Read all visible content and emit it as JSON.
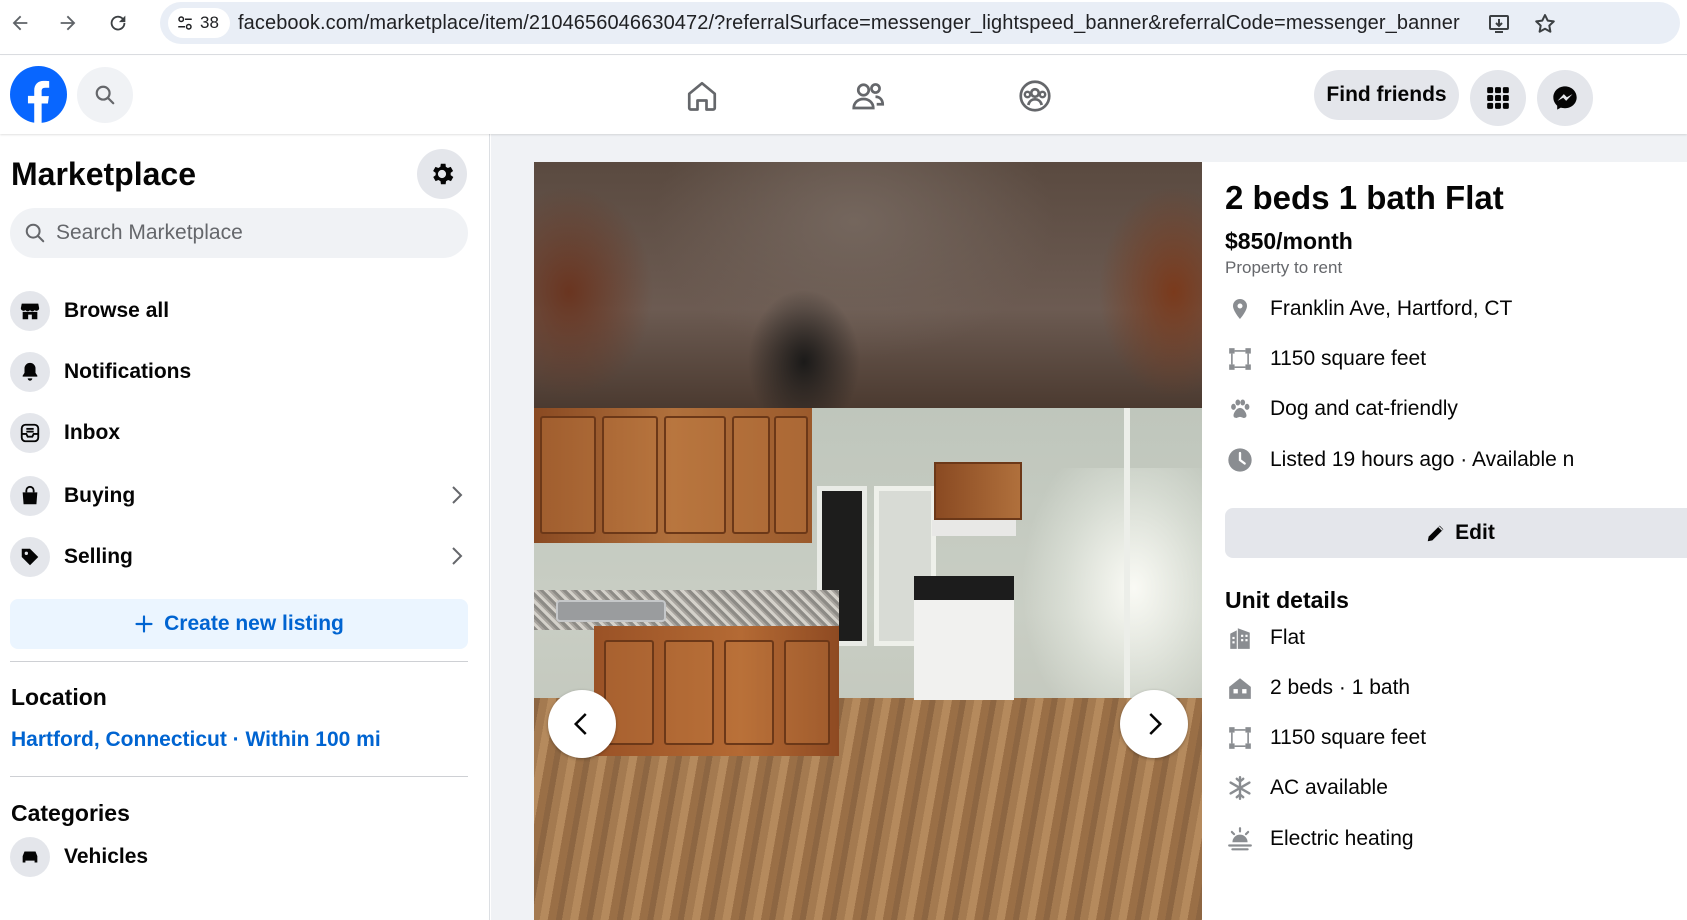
{
  "browser": {
    "tab_count": "38",
    "url": "facebook.com/marketplace/item/2104656046630472/?referralSurface=messenger_lightspeed_banner&referralCode=messenger_banner"
  },
  "header": {
    "find_friends_label": "Find friends",
    "brand_color": "#0866ff"
  },
  "sidebar": {
    "title": "Marketplace",
    "search_placeholder": "Search Marketplace",
    "items": [
      {
        "label": "Browse all",
        "icon": "storefront-icon"
      },
      {
        "label": "Notifications",
        "icon": "bell-icon"
      },
      {
        "label": "Inbox",
        "icon": "inbox-icon"
      },
      {
        "label": "Buying",
        "icon": "shopping-bag-icon"
      },
      {
        "label": "Selling",
        "icon": "tag-icon"
      }
    ],
    "create_listing_label": "Create new listing",
    "location_title": "Location",
    "location_value": "Hartford, Connecticut · Within 100 mi",
    "categories_title": "Categories",
    "first_category": "Vehicles"
  },
  "listing": {
    "title": "2 beds 1 bath Flat",
    "price": "$850/month",
    "type": "Property to rent",
    "facts": [
      {
        "icon": "location-pin-icon",
        "text": "Franklin Ave, Hartford, CT"
      },
      {
        "icon": "square-feet-icon",
        "text": "1150 square feet"
      },
      {
        "icon": "paw-icon",
        "text": "Dog and cat-friendly"
      },
      {
        "icon": "clock-icon",
        "text": "Listed 19 hours ago · Available n"
      }
    ],
    "edit_label": "Edit",
    "unit_details_title": "Unit details",
    "unit_details": [
      {
        "icon": "building-icon",
        "text": "Flat"
      },
      {
        "icon": "house-icon",
        "text": "2 beds · 1 bath"
      },
      {
        "icon": "square-feet-icon",
        "text": "1150 square feet"
      },
      {
        "icon": "snowflake-icon",
        "text": "AC available"
      },
      {
        "icon": "heating-icon",
        "text": "Electric heating"
      }
    ]
  }
}
